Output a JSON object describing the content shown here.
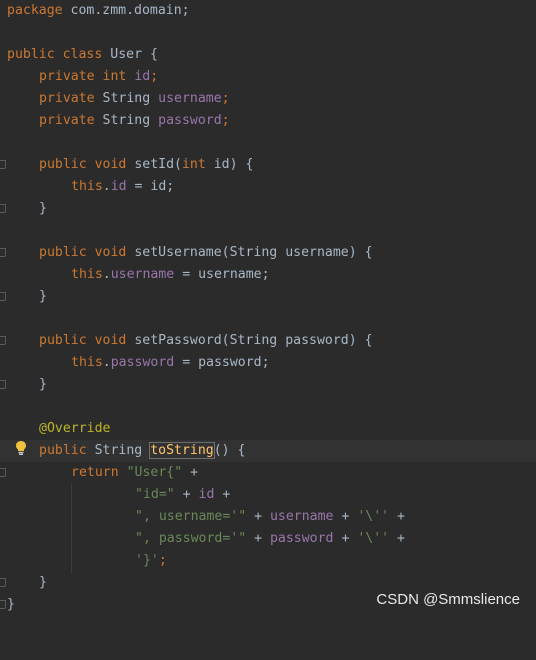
{
  "code": {
    "l1": {
      "kw": "package",
      "rest": " com.zmm.domain;"
    },
    "l3": {
      "kw1": "public",
      "kw2": "class",
      "cls": "User",
      "brace": " {"
    },
    "l4": {
      "kw": "private",
      "type": "int",
      "field": "id",
      "semi": ";"
    },
    "l5": {
      "kw": "private",
      "type": "String",
      "field": "username",
      "semi": ";"
    },
    "l6": {
      "kw": "private",
      "type": "String",
      "field": "password",
      "semi": ";"
    },
    "l8": {
      "kw1": "public",
      "kw2": "void",
      "method": "setId",
      "p1": "(",
      "ptype": "int",
      "pname": " id",
      "p2": ") {"
    },
    "l9": {
      "this": "this",
      "dot": ".",
      "field": "id",
      "rest": " = id;"
    },
    "l10": {
      "text": "}"
    },
    "l12": {
      "kw1": "public",
      "kw2": "void",
      "method": "setUsername",
      "p1": "(",
      "ptype": "String",
      "pname": " username",
      "p2": ") {"
    },
    "l13": {
      "this": "this",
      "dot": ".",
      "field": "username",
      "rest": " = username;"
    },
    "l14": {
      "text": "}"
    },
    "l16": {
      "kw1": "public",
      "kw2": "void",
      "method": "setPassword",
      "p1": "(",
      "ptype": "String",
      "pname": " password",
      "p2": ") {"
    },
    "l17": {
      "this": "this",
      "dot": ".",
      "field": "password",
      "rest": " = password;"
    },
    "l18": {
      "text": "}"
    },
    "l20": {
      "ann": "@Override"
    },
    "l21": {
      "kw": "public",
      "type": "String",
      "method": "toString",
      "rest": "() {"
    },
    "l22": {
      "kw": "return",
      "str": "\"User{\"",
      "rest": " +"
    },
    "l23": {
      "str": "\"id=\"",
      "plus": " + ",
      "field": "id",
      "rest": " +"
    },
    "l24": {
      "str": "\", username='\"",
      "plus": " + ",
      "field": "username",
      "plus2": " + ",
      "str2": "'\\''",
      "rest": " +"
    },
    "l25": {
      "str": "\", password='\"",
      "plus": " + ",
      "field": "password",
      "plus2": " + ",
      "str2": "'\\''",
      "rest": " +"
    },
    "l26": {
      "str": "'}'",
      "rest": ";"
    },
    "l27": {
      "text": "}"
    },
    "l28": {
      "text": "}"
    }
  },
  "watermark": "CSDN @Smmslience",
  "colors": {
    "background": "#2b2b2b",
    "keyword": "#cc7832",
    "field": "#9876aa",
    "string": "#6a8759",
    "annotation": "#bbb529",
    "method_decl": "#ffc66d",
    "default_text": "#a9b7c6"
  },
  "icons": {
    "intention": "lightbulb-icon"
  }
}
